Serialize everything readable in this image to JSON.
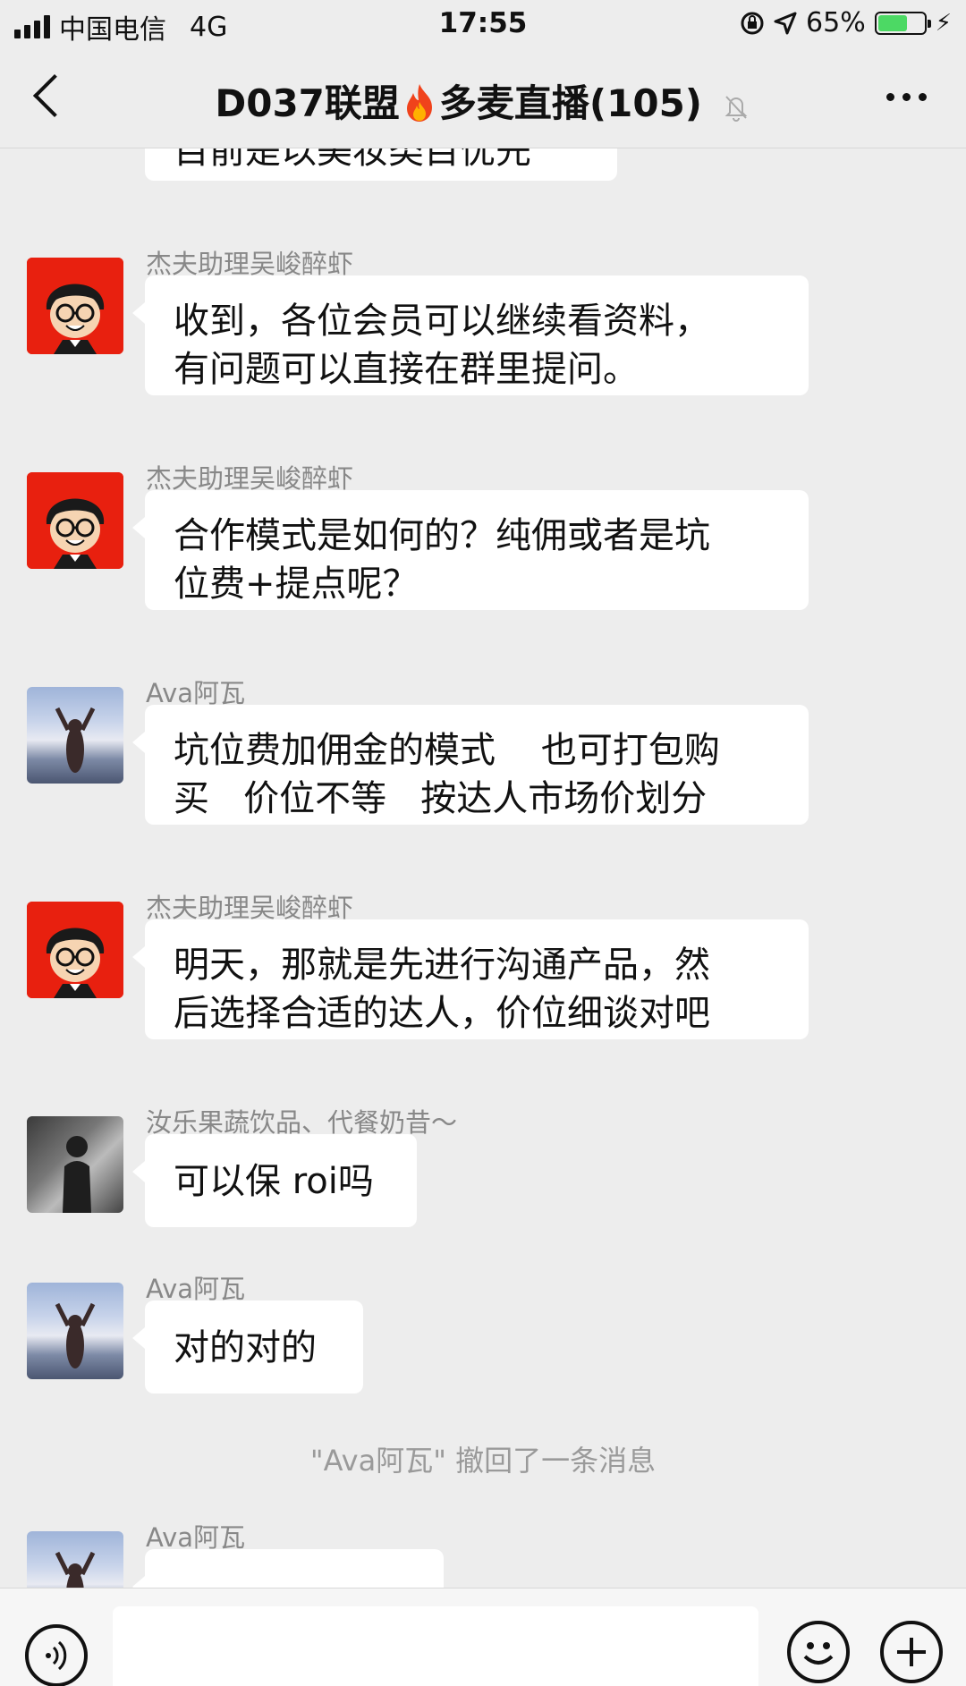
{
  "status_bar": {
    "carrier": "中国电信",
    "network": "4G",
    "time": "17:55",
    "battery": "65%",
    "battery_level": 0.65
  },
  "header": {
    "title_left": "D037联盟",
    "title_right": "多麦直播(105)",
    "fire_icon": "fire-emoji",
    "muted_icon": "bell-off-icon"
  },
  "messages": [
    {
      "sender": "",
      "lines": [
        "目前是以美妆类目优先"
      ]
    },
    {
      "sender": "杰夫助理吴峻醉虾",
      "lines": [
        "收到，各位会员可以继续看资料，",
        "有问题可以直接在群里提问。"
      ]
    },
    {
      "sender": "杰夫助理吴峻醉虾",
      "lines": [
        "合作模式是如何的？纯佣或者是坑",
        "位费+提点呢？"
      ]
    },
    {
      "sender": "Ava阿瓦",
      "lines": [
        "坑位费加佣金的模式    也可打包购",
        "买   价位不等   按达人市场价划分"
      ]
    },
    {
      "sender": "杰夫助理吴峻醉虾",
      "lines": [
        "明天，那就是先进行沟通产品，然",
        "后选择合适的达人，价位细谈对吧"
      ]
    },
    {
      "sender": "汝乐果蔬饮品、代餐奶昔～",
      "lines": [
        "可以保 roi吗"
      ]
    },
    {
      "sender": "Ava阿瓦",
      "lines": [
        "对的对的"
      ]
    },
    {
      "sender": "Ava阿瓦",
      "lines": []
    }
  ],
  "system_notice": "\"Ava阿瓦\" 撤回了一条消息",
  "colors": {
    "background": "#ededed",
    "bubble": "#ffffff",
    "sender_text": "#888888",
    "battery_green": "#4cd964",
    "avatar_red": "#e8200f"
  },
  "input_bar": {
    "voice_icon": "voice-icon",
    "emoji_icon": "emoji-icon",
    "plus_icon": "plus-icon"
  }
}
